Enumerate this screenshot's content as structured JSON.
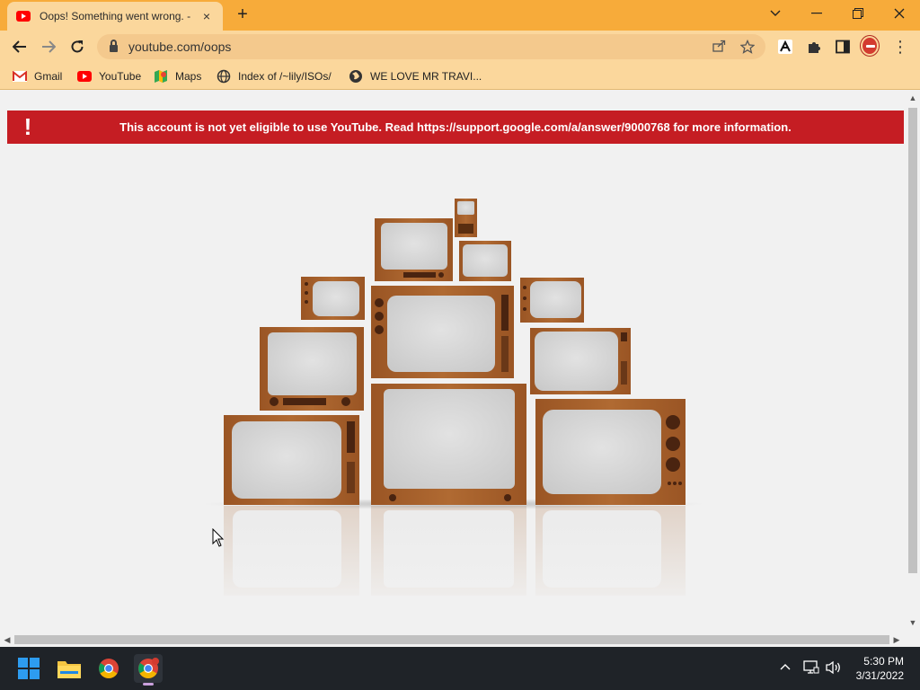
{
  "browser": {
    "tab": {
      "title": "Oops! Something went wrong. -",
      "close_icon": "×"
    },
    "new_tab_icon": "+",
    "window_controls": {
      "dropdown": "⌵",
      "minimize": "–",
      "maximize": "❐",
      "close": "✕"
    },
    "nav": {
      "back": "←",
      "forward": "→",
      "reload": "↻"
    },
    "url": "youtube.com/oops",
    "menu_icon": "⋮"
  },
  "bookmarks": [
    {
      "label": "Gmail",
      "icon": "gmail-icon"
    },
    {
      "label": "YouTube",
      "icon": "youtube-icon"
    },
    {
      "label": "Maps",
      "icon": "maps-icon"
    },
    {
      "label": "Index of /~lily/ISOs/",
      "icon": "folder-globe-icon"
    },
    {
      "label": "WE LOVE MR TRAVI...",
      "icon": "globe-icon"
    }
  ],
  "page": {
    "alert": {
      "icon": "!",
      "message": "This account is not yet eligible to use YouTube. Read https://support.google.com/a/answer/9000768 for more information."
    }
  },
  "taskbar": {
    "time": "5:30 PM",
    "date": "3/31/2022",
    "tray_chevron": "^"
  },
  "colors": {
    "tab_strip": "#f7ab3a",
    "toolbar": "#fbd79c",
    "alert_red": "#c51d23",
    "tv_wood": "#a8612c",
    "taskbar": "#1f2328"
  }
}
